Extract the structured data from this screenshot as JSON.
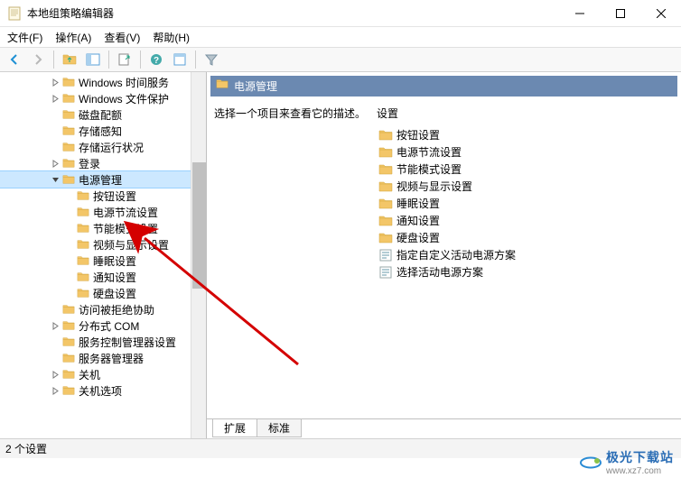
{
  "window": {
    "title": "本地组策略编辑器"
  },
  "menu": {
    "file": "文件(F)",
    "action": "操作(A)",
    "view": "查看(V)",
    "help": "帮助(H)"
  },
  "tree": {
    "items": [
      {
        "depth": 3,
        "exp": ">",
        "label": "Windows 时间服务"
      },
      {
        "depth": 3,
        "exp": ">",
        "label": "Windows 文件保护"
      },
      {
        "depth": 3,
        "exp": "",
        "label": "磁盘配额"
      },
      {
        "depth": 3,
        "exp": "",
        "label": "存储感知"
      },
      {
        "depth": 3,
        "exp": "",
        "label": "存储运行状况"
      },
      {
        "depth": 3,
        "exp": ">",
        "label": "登录"
      },
      {
        "depth": 3,
        "exp": "v",
        "label": "电源管理",
        "sel": true
      },
      {
        "depth": 4,
        "exp": "",
        "label": "按钮设置"
      },
      {
        "depth": 4,
        "exp": "",
        "label": "电源节流设置"
      },
      {
        "depth": 4,
        "exp": "",
        "label": "节能模式设置"
      },
      {
        "depth": 4,
        "exp": "",
        "label": "视频与显示设置"
      },
      {
        "depth": 4,
        "exp": "",
        "label": "睡眠设置"
      },
      {
        "depth": 4,
        "exp": "",
        "label": "通知设置"
      },
      {
        "depth": 4,
        "exp": "",
        "label": "硬盘设置"
      },
      {
        "depth": 3,
        "exp": "",
        "label": "访问被拒绝协助"
      },
      {
        "depth": 3,
        "exp": ">",
        "label": "分布式 COM"
      },
      {
        "depth": 3,
        "exp": "",
        "label": "服务控制管理器设置"
      },
      {
        "depth": 3,
        "exp": "",
        "label": "服务器管理器"
      },
      {
        "depth": 3,
        "exp": ">",
        "label": "关机"
      },
      {
        "depth": 3,
        "exp": ">",
        "label": "关机选项"
      }
    ]
  },
  "detail": {
    "header": "电源管理",
    "prompt": "选择一个项目来查看它的描述。",
    "column": "设置",
    "items": [
      {
        "type": "folder",
        "label": "按钮设置"
      },
      {
        "type": "folder",
        "label": "电源节流设置"
      },
      {
        "type": "folder",
        "label": "节能模式设置"
      },
      {
        "type": "folder",
        "label": "视频与显示设置"
      },
      {
        "type": "folder",
        "label": "睡眠设置"
      },
      {
        "type": "folder",
        "label": "通知设置"
      },
      {
        "type": "folder",
        "label": "硬盘设置"
      },
      {
        "type": "setting",
        "label": "指定自定义活动电源方案"
      },
      {
        "type": "setting",
        "label": "选择活动电源方案"
      }
    ]
  },
  "tabs": {
    "extended": "扩展",
    "standard": "标准"
  },
  "status": "2 个设置",
  "watermark": {
    "brand": "极光下载站",
    "url": "www.xz7.com"
  }
}
